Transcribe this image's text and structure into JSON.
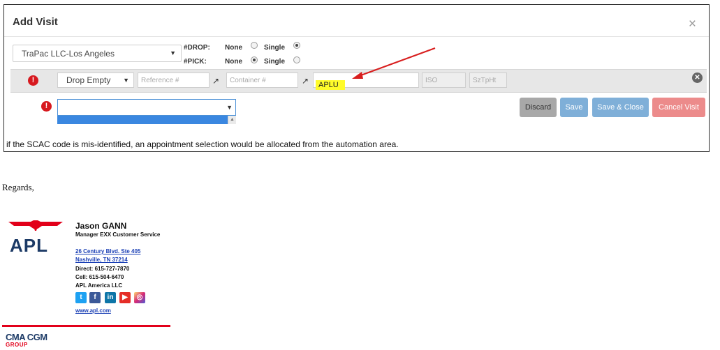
{
  "modal": {
    "title": "Add Visit",
    "close_symbol": "×",
    "terminal": "TraPac LLC-Los Angeles",
    "drop_label": "#DROP:",
    "pick_label": "#PICK:",
    "drop_options": [
      {
        "label": "None",
        "checked": false
      },
      {
        "label": "Single",
        "checked": true
      }
    ],
    "pick_options": [
      {
        "label": "None",
        "checked": true
      },
      {
        "label": "Single",
        "checked": false
      }
    ]
  },
  "visit_row": {
    "type_value": "Drop Empty",
    "reference_placeholder": "Reference #",
    "container_placeholder": "Container #",
    "scac_value": "APLU",
    "iso_placeholder": "ISO",
    "sztpht_placeholder": "SzTpHt"
  },
  "buttons": {
    "discard": "Discard",
    "save": "Save",
    "save_close": "Save & Close",
    "cancel_visit": "Cancel Visit"
  },
  "note": "if the SCAC code is mis-identified, an appointment selection would be allocated from the automation area.",
  "colors": {
    "error": "#d7191f",
    "highlight": "#fffb2a",
    "arrow": "#d81e1e",
    "primary_button": "#7fafd8",
    "cancel_button": "#ec8b8b",
    "brand_navy": "#1c3a66",
    "brand_red": "#e2001a"
  },
  "email": {
    "regards": "Regards,"
  },
  "signature": {
    "name": "Jason GANN",
    "title": "Manager EXX Customer Service",
    "address_line1": "26 Century Blvd. Ste 405",
    "address_line2": "Nashville, TN 37214",
    "direct": "Direct: 615-727-7870",
    "cell": "Cell: 615-504-6470",
    "company": "APL America LLC",
    "website": "www.apl.com",
    "logo_text": "APL",
    "group_logo": "CMA CGM",
    "group_sub": "GROUP",
    "social_icons": [
      "twitter-icon",
      "facebook-icon",
      "linkedin-icon",
      "youtube-icon",
      "instagram-icon"
    ]
  }
}
